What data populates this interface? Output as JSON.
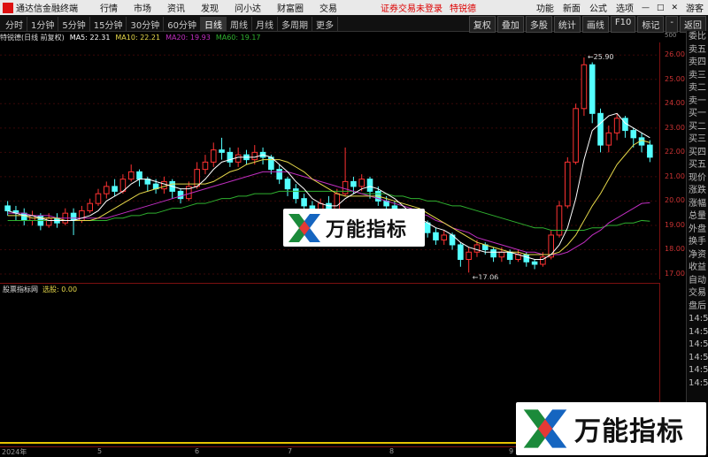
{
  "menubar": {
    "app_title": "通达信金融终端",
    "items": [
      "行情",
      "市场",
      "资讯",
      "发现",
      "问小达",
      "财富圈",
      "交易"
    ],
    "login_warning": "证券交易未登录",
    "stock_name": "特锐德",
    "right_items": [
      "功能",
      "新面",
      "公式",
      "选项"
    ],
    "user": "游客"
  },
  "toolbar": {
    "periods": [
      "分时",
      "1分钟",
      "5分钟",
      "15分钟",
      "30分钟",
      "60分钟",
      "日线",
      "周线",
      "月线",
      "多周期",
      "更多"
    ],
    "selected_period": "日线",
    "tools": [
      "复权",
      "叠加",
      "多股",
      "统计",
      "画线",
      "F10",
      "标记",
      "-",
      "返回"
    ]
  },
  "legend": {
    "title": "特锐德(日线 前复权)",
    "ma5": "MA5: 22.31",
    "ma10": "MA10: 22.21",
    "ma20": "MA20: 19.93",
    "ma60": "MA60: 19.17"
  },
  "price_axis": [
    "26.00",
    "25.00",
    "24.00",
    "23.00",
    "22.00",
    "21.00",
    "20.00",
    "19.00",
    "18.00",
    "17.00"
  ],
  "price_axis_unit": "500",
  "annotations": {
    "high": "25.90",
    "low": "17.06"
  },
  "indicator": {
    "name": "股票指标网",
    "value": "选股: 0.00"
  },
  "side_panel": [
    "委比",
    "卖五",
    "卖四",
    "卖三",
    "卖二",
    "卖一",
    "买一",
    "买二",
    "买三",
    "买四",
    "买五",
    "现价",
    "涨跌",
    "涨幅",
    "总量",
    "外盘",
    "换手",
    "净资",
    "收益",
    "自动",
    "交易",
    "盘后",
    "14:5",
    "14:5",
    "14:5",
    "14:5",
    "14:5",
    "14:5"
  ],
  "date_axis": [
    "2024年",
    "5",
    "6",
    "7",
    "8",
    "9",
    "10"
  ],
  "watermark": {
    "text": "万能指标"
  },
  "chart_data": {
    "type": "candlestick",
    "ylim": [
      17,
      26.3
    ],
    "candles": [
      [
        19.8,
        19.6,
        20.0,
        19.4
      ],
      [
        19.6,
        19.5,
        19.8,
        19.2
      ],
      [
        19.5,
        19.2,
        19.7,
        19.0
      ],
      [
        19.2,
        19.4,
        19.6,
        19.0
      ],
      [
        19.4,
        19.0,
        19.5,
        18.8
      ],
      [
        19.0,
        19.3,
        19.5,
        18.9
      ],
      [
        19.3,
        19.1,
        19.5,
        18.9
      ],
      [
        19.1,
        19.5,
        19.7,
        19.0
      ],
      [
        19.5,
        19.2,
        19.7,
        18.6
      ],
      [
        19.2,
        19.6,
        19.8,
        19.1
      ],
      [
        19.6,
        19.9,
        20.1,
        19.5
      ],
      [
        19.9,
        20.3,
        20.5,
        19.8
      ],
      [
        20.3,
        20.6,
        20.8,
        20.1
      ],
      [
        20.6,
        20.4,
        20.9,
        20.2
      ],
      [
        20.4,
        20.9,
        21.1,
        20.3
      ],
      [
        20.9,
        21.2,
        21.5,
        20.8
      ],
      [
        21.2,
        20.9,
        21.3,
        20.6
      ],
      [
        20.9,
        20.7,
        21.0,
        20.4
      ],
      [
        20.7,
        20.5,
        20.9,
        20.3
      ],
      [
        20.5,
        20.8,
        21.0,
        20.3
      ],
      [
        20.8,
        20.4,
        20.9,
        20.1
      ],
      [
        20.4,
        20.1,
        20.5,
        19.9
      ],
      [
        20.1,
        20.6,
        20.8,
        20.0
      ],
      [
        20.6,
        21.3,
        21.6,
        20.5
      ],
      [
        21.3,
        21.6,
        21.9,
        21.1
      ],
      [
        21.6,
        22.1,
        22.4,
        21.4
      ],
      [
        22.1,
        22.0,
        22.6,
        21.7
      ],
      [
        22.0,
        21.6,
        22.2,
        21.4
      ],
      [
        21.6,
        21.9,
        22.2,
        21.4
      ],
      [
        21.9,
        21.7,
        22.1,
        21.5
      ],
      [
        21.7,
        22.0,
        22.3,
        21.5
      ],
      [
        22.0,
        21.8,
        22.2,
        21.5
      ],
      [
        21.8,
        21.3,
        21.9,
        21.1
      ],
      [
        21.3,
        20.9,
        21.5,
        20.7
      ],
      [
        20.9,
        20.5,
        21.0,
        20.2
      ],
      [
        20.5,
        20.1,
        20.7,
        19.9
      ],
      [
        20.1,
        19.8,
        20.3,
        19.6
      ],
      [
        19.8,
        19.5,
        20.0,
        19.3
      ],
      [
        19.5,
        19.9,
        20.1,
        19.4
      ],
      [
        19.9,
        19.6,
        20.2,
        19.4
      ],
      [
        19.6,
        20.3,
        20.5,
        19.5
      ],
      [
        20.3,
        20.8,
        22.2,
        20.2
      ],
      [
        20.8,
        20.6,
        21.0,
        20.3
      ],
      [
        20.6,
        20.9,
        21.1,
        20.4
      ],
      [
        20.9,
        20.4,
        21.0,
        20.1
      ],
      [
        20.4,
        20.0,
        20.6,
        19.8
      ],
      [
        20.0,
        19.8,
        20.2,
        19.5
      ],
      [
        19.8,
        19.5,
        20.0,
        19.3
      ],
      [
        19.5,
        19.2,
        19.7,
        18.9
      ],
      [
        19.2,
        18.9,
        19.4,
        18.7
      ],
      [
        18.9,
        19.1,
        19.3,
        18.7
      ],
      [
        19.1,
        18.7,
        19.2,
        18.5
      ],
      [
        18.7,
        18.4,
        18.9,
        18.2
      ],
      [
        18.4,
        18.6,
        18.8,
        18.2
      ],
      [
        18.6,
        18.2,
        18.7,
        18.0
      ],
      [
        18.2,
        17.6,
        18.3,
        17.3
      ],
      [
        17.6,
        17.9,
        18.1,
        17.06
      ],
      [
        17.9,
        18.2,
        18.4,
        17.7
      ],
      [
        18.2,
        18.0,
        18.3,
        17.8
      ],
      [
        18.0,
        17.7,
        18.1,
        17.5
      ],
      [
        17.7,
        17.9,
        18.1,
        17.5
      ],
      [
        17.9,
        17.6,
        18.0,
        17.4
      ],
      [
        17.6,
        17.8,
        18.0,
        17.5
      ],
      [
        17.8,
        17.5,
        17.9,
        17.3
      ],
      [
        17.5,
        17.4,
        17.6,
        17.2
      ],
      [
        17.4,
        17.7,
        17.9,
        17.3
      ],
      [
        17.7,
        18.6,
        18.8,
        17.6
      ],
      [
        18.6,
        19.8,
        20.0,
        18.5
      ],
      [
        19.8,
        21.6,
        21.8,
        19.7
      ],
      [
        21.6,
        23.8,
        24.0,
        21.5
      ],
      [
        23.8,
        25.6,
        25.9,
        23.5
      ],
      [
        25.6,
        23.6,
        25.7,
        23.2
      ],
      [
        23.6,
        22.3,
        23.8,
        22.0
      ],
      [
        22.3,
        22.8,
        23.1,
        22.0
      ],
      [
        22.8,
        23.4,
        23.6,
        22.5
      ],
      [
        23.4,
        22.9,
        23.5,
        22.6
      ],
      [
        22.9,
        22.6,
        23.0,
        22.2
      ],
      [
        22.6,
        22.3,
        22.8,
        22.0
      ],
      [
        22.3,
        21.8,
        22.5,
        21.6
      ]
    ],
    "ma5": [
      19.6,
      19.5,
      19.4,
      19.4,
      19.3,
      19.2,
      19.2,
      19.2,
      19.2,
      19.3,
      19.4,
      19.6,
      20.0,
      20.2,
      20.4,
      20.7,
      20.9,
      20.9,
      20.8,
      20.7,
      20.6,
      20.5,
      20.5,
      20.6,
      20.9,
      21.3,
      21.6,
      21.7,
      21.8,
      21.8,
      21.8,
      21.9,
      21.8,
      21.5,
      21.2,
      20.8,
      20.5,
      20.1,
      19.9,
      19.8,
      19.8,
      20.1,
      20.3,
      20.5,
      20.6,
      20.5,
      20.3,
      20.1,
      19.8,
      19.5,
      19.3,
      19.1,
      18.9,
      18.8,
      18.6,
      18.3,
      18.1,
      18.0,
      17.9,
      17.9,
      17.9,
      17.9,
      17.8,
      17.7,
      17.6,
      17.6,
      17.8,
      18.2,
      18.9,
      20.1,
      21.7,
      22.9,
      23.2,
      23.5,
      23.6,
      23.2,
      23.0,
      22.8,
      22.6
    ],
    "ma10": [
      19.4,
      19.4,
      19.4,
      19.3,
      19.3,
      19.3,
      19.3,
      19.2,
      19.2,
      19.2,
      19.2,
      19.3,
      19.5,
      19.7,
      19.9,
      20.1,
      20.3,
      20.4,
      20.5,
      20.6,
      20.7,
      20.7,
      20.7,
      20.7,
      20.7,
      20.8,
      21.0,
      21.2,
      21.3,
      21.5,
      21.6,
      21.7,
      21.7,
      21.7,
      21.6,
      21.4,
      21.2,
      20.9,
      20.7,
      20.5,
      20.3,
      20.2,
      20.2,
      20.2,
      20.2,
      20.2,
      20.1,
      20.0,
      19.9,
      19.8,
      19.7,
      19.5,
      19.3,
      19.1,
      18.9,
      18.7,
      18.5,
      18.3,
      18.2,
      18.1,
      18.0,
      17.9,
      17.9,
      17.8,
      17.8,
      17.8,
      17.8,
      17.9,
      18.2,
      18.6,
      19.2,
      19.8,
      20.3,
      20.9,
      21.5,
      21.9,
      22.3,
      22.5,
      22.4
    ],
    "ma20": [
      19.5,
      19.5,
      19.5,
      19.4,
      19.4,
      19.4,
      19.3,
      19.3,
      19.3,
      19.3,
      19.3,
      19.3,
      19.3,
      19.4,
      19.5,
      19.6,
      19.7,
      19.8,
      19.9,
      20.0,
      20.1,
      20.2,
      20.3,
      20.4,
      20.5,
      20.6,
      20.7,
      20.8,
      20.9,
      21.0,
      21.1,
      21.2,
      21.2,
      21.2,
      21.2,
      21.1,
      21.0,
      20.9,
      20.8,
      20.7,
      20.6,
      20.5,
      20.4,
      20.3,
      20.2,
      20.1,
      20.0,
      19.9,
      19.8,
      19.7,
      19.5,
      19.4,
      19.2,
      19.1,
      18.9,
      18.8,
      18.7,
      18.5,
      18.4,
      18.3,
      18.2,
      18.1,
      18.0,
      17.9,
      17.9,
      17.8,
      17.8,
      17.8,
      17.9,
      18.1,
      18.3,
      18.6,
      18.8,
      19.1,
      19.3,
      19.5,
      19.7,
      19.9,
      19.93
    ],
    "ma60": [
      19.2,
      19.2,
      19.2,
      19.2,
      19.2,
      19.2,
      19.2,
      19.2,
      19.2,
      19.2,
      19.2,
      19.2,
      19.2,
      19.3,
      19.3,
      19.4,
      19.4,
      19.5,
      19.5,
      19.6,
      19.7,
      19.7,
      19.8,
      19.9,
      19.9,
      20.0,
      20.1,
      20.1,
      20.2,
      20.2,
      20.3,
      20.3,
      20.3,
      20.4,
      20.4,
      20.4,
      20.4,
      20.4,
      20.4,
      20.4,
      20.4,
      20.4,
      20.4,
      20.3,
      20.3,
      20.3,
      20.3,
      20.2,
      20.2,
      20.1,
      20.1,
      20.0,
      20.0,
      19.9,
      19.8,
      19.8,
      19.7,
      19.6,
      19.5,
      19.4,
      19.3,
      19.2,
      19.1,
      19.0,
      18.9,
      18.9,
      18.8,
      18.8,
      18.8,
      18.8,
      18.8,
      18.9,
      18.9,
      19.0,
      19.0,
      19.1,
      19.1,
      19.2,
      19.17
    ]
  }
}
